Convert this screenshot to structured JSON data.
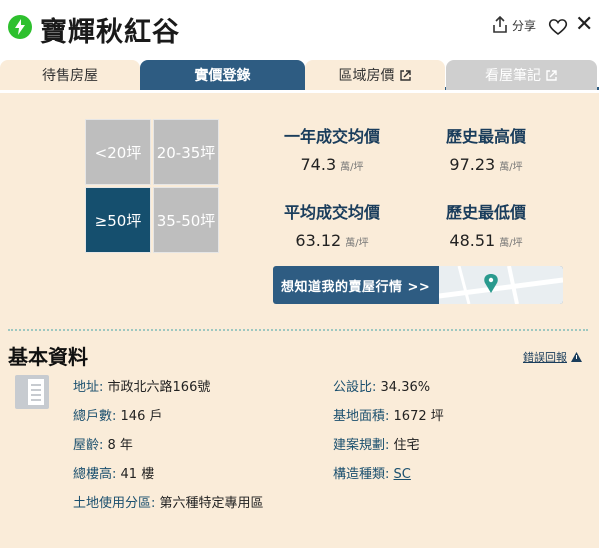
{
  "header": {
    "title": "寶輝秋紅谷",
    "share_label": "分享",
    "icons": [
      "lightning-icon",
      "share-icon",
      "heart-icon",
      "close-icon"
    ]
  },
  "tabs": [
    {
      "label": "待售房屋",
      "external": false,
      "active": false
    },
    {
      "label": "實價登錄",
      "external": false,
      "active": true
    },
    {
      "label": "區域房價",
      "external": true,
      "active": false
    },
    {
      "label": "看屋筆記",
      "external": true,
      "disabled": true
    }
  ],
  "size_filters": [
    {
      "label": "<20坪",
      "active": false
    },
    {
      "label": "20-35坪",
      "active": false
    },
    {
      "label": "≥50坪",
      "active": true
    },
    {
      "label": "35-50坪",
      "active": false
    }
  ],
  "stats": {
    "one_year": {
      "label": "一年成交均價",
      "value": "74.3",
      "unit": "萬/坪"
    },
    "hist_high": {
      "label": "歷史最高價",
      "value": "97.23",
      "unit": "萬/坪"
    },
    "average": {
      "label": "平均成交均價",
      "value": "63.12",
      "unit": "萬/坪"
    },
    "hist_low": {
      "label": "歷史最低價",
      "value": "48.51",
      "unit": "萬/坪"
    }
  },
  "banner": {
    "text": "想知道我的賣屋行情 >>"
  },
  "basic_info": {
    "title": "基本資料",
    "report_label": "錯誤回報",
    "address_label": "地址:",
    "address_value": "市政北六路166號",
    "households_label": "總戶數:",
    "households_value": "146 戶",
    "age_label": "屋齡:",
    "age_value": "8 年",
    "floors_label": "總樓高:",
    "floors_value": "41 樓",
    "zoning_label": "土地使用分區:",
    "zoning_value": "第六種特定專用區",
    "public_ratio_label": "公設比:",
    "public_ratio_value": "34.36%",
    "land_area_label": "基地面積:",
    "land_area_value": "1672 坪",
    "plan_label": "建案規劃:",
    "plan_value": "住宅",
    "structure_label": "構造種類:",
    "structure_value": "SC"
  },
  "colors": {
    "accent": "#2e5c82",
    "active_filter": "#154f6e",
    "panel_bg": "#faecd9",
    "highlight": "#f5d76e",
    "brand_green": "#2ec02e"
  }
}
